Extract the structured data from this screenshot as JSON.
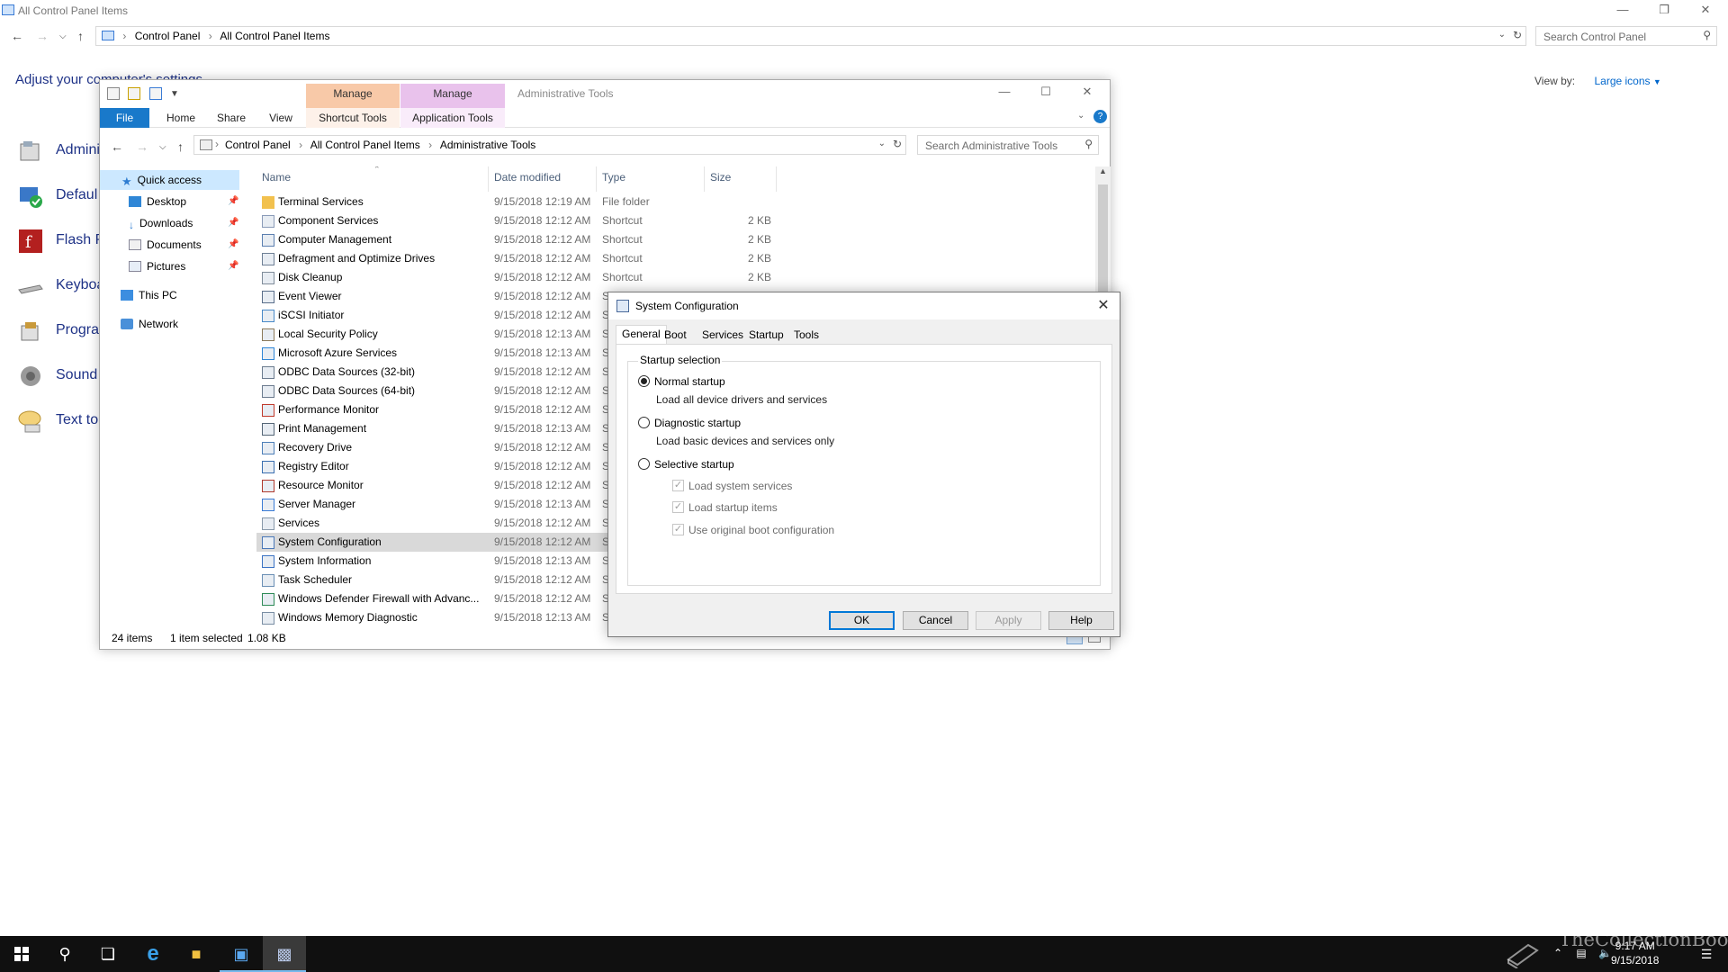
{
  "control_panel": {
    "window_title": "All Control Panel Items",
    "breadcrumbs": [
      "Control Panel",
      "All Control Panel Items"
    ],
    "search_placeholder": "Search Control Panel",
    "heading": "Adjust your computer's settings",
    "view_by_label": "View by:",
    "view_by_value": "Large icons",
    "items": [
      {
        "label": "Admini",
        "icon": "admin-tools-icon"
      },
      {
        "label": "Defaul",
        "icon": "default-programs-icon"
      },
      {
        "label": "Flash P",
        "icon": "flash-player-icon"
      },
      {
        "label": "Keyboa",
        "icon": "keyboard-icon"
      },
      {
        "label": "Progra",
        "icon": "programs-icon"
      },
      {
        "label": "Sound",
        "icon": "sound-icon"
      },
      {
        "label": "Text to",
        "icon": "text-to-speech-icon"
      }
    ]
  },
  "explorer": {
    "title": "Administrative Tools",
    "context_tabs": [
      {
        "label": "Manage",
        "group": "Shortcut Tools",
        "color": "#f8c9a8"
      },
      {
        "label": "Manage",
        "group": "Application Tools",
        "color": "#e9c2ec"
      }
    ],
    "ribbon_tabs": [
      "File",
      "Home",
      "Share",
      "View",
      "Shortcut Tools",
      "Application Tools"
    ],
    "breadcrumbs": [
      "Control Panel",
      "All Control Panel Items",
      "Administrative Tools"
    ],
    "search_placeholder": "Search Administrative Tools",
    "nav": {
      "quick_access": "Quick access",
      "desktop": "Desktop",
      "downloads": "Downloads",
      "documents": "Documents",
      "pictures": "Pictures",
      "this_pc": "This PC",
      "network": "Network"
    },
    "columns": [
      "Name",
      "Date modified",
      "Type",
      "Size"
    ],
    "rows": [
      {
        "name": "Terminal Services",
        "date": "9/15/2018 12:19 AM",
        "type": "File folder",
        "size": ""
      },
      {
        "name": "Component Services",
        "date": "9/15/2018 12:12 AM",
        "type": "Shortcut",
        "size": "2 KB"
      },
      {
        "name": "Computer Management",
        "date": "9/15/2018 12:12 AM",
        "type": "Shortcut",
        "size": "2 KB"
      },
      {
        "name": "Defragment and Optimize Drives",
        "date": "9/15/2018 12:12 AM",
        "type": "Shortcut",
        "size": "2 KB"
      },
      {
        "name": "Disk Cleanup",
        "date": "9/15/2018 12:12 AM",
        "type": "Shortcut",
        "size": "2 KB"
      },
      {
        "name": "Event Viewer",
        "date": "9/15/2018 12:12 AM",
        "type": "Shortcut",
        "size": "2 KB"
      },
      {
        "name": "iSCSI Initiator",
        "date": "9/15/2018 12:12 AM",
        "type": "S",
        "size": ""
      },
      {
        "name": "Local Security Policy",
        "date": "9/15/2018 12:13 AM",
        "type": "S",
        "size": ""
      },
      {
        "name": "Microsoft Azure Services",
        "date": "9/15/2018 12:13 AM",
        "type": "S",
        "size": ""
      },
      {
        "name": "ODBC Data Sources (32-bit)",
        "date": "9/15/2018 12:12 AM",
        "type": "S",
        "size": ""
      },
      {
        "name": "ODBC Data Sources (64-bit)",
        "date": "9/15/2018 12:12 AM",
        "type": "S",
        "size": ""
      },
      {
        "name": "Performance Monitor",
        "date": "9/15/2018 12:12 AM",
        "type": "S",
        "size": ""
      },
      {
        "name": "Print Management",
        "date": "9/15/2018 12:13 AM",
        "type": "S",
        "size": ""
      },
      {
        "name": "Recovery Drive",
        "date": "9/15/2018 12:12 AM",
        "type": "S",
        "size": ""
      },
      {
        "name": "Registry Editor",
        "date": "9/15/2018 12:12 AM",
        "type": "S",
        "size": ""
      },
      {
        "name": "Resource Monitor",
        "date": "9/15/2018 12:12 AM",
        "type": "S",
        "size": ""
      },
      {
        "name": "Server Manager",
        "date": "9/15/2018 12:13 AM",
        "type": "S",
        "size": ""
      },
      {
        "name": "Services",
        "date": "9/15/2018 12:12 AM",
        "type": "S",
        "size": ""
      },
      {
        "name": "System Configuration",
        "date": "9/15/2018 12:12 AM",
        "type": "S",
        "size": "",
        "selected": true
      },
      {
        "name": "System Information",
        "date": "9/15/2018 12:13 AM",
        "type": "S",
        "size": ""
      },
      {
        "name": "Task Scheduler",
        "date": "9/15/2018 12:12 AM",
        "type": "S",
        "size": ""
      },
      {
        "name": "Windows Defender Firewall with Advanc...",
        "date": "9/15/2018 12:12 AM",
        "type": "S",
        "size": ""
      },
      {
        "name": "Windows Memory Diagnostic",
        "date": "9/15/2018 12:13 AM",
        "type": "S",
        "size": ""
      }
    ],
    "status": {
      "count": "24 items",
      "selected": "1 item selected",
      "size": "1.08 KB"
    }
  },
  "dialog": {
    "title": "System Configuration",
    "tabs": [
      "General",
      "Boot",
      "Services",
      "Startup",
      "Tools"
    ],
    "group_label": "Startup selection",
    "normal": {
      "label": "Normal startup",
      "desc": "Load all device drivers and services",
      "checked": true
    },
    "diagnostic": {
      "label": "Diagnostic startup",
      "desc": "Load basic devices and services only",
      "checked": false
    },
    "selective": {
      "label": "Selective startup",
      "checked": false
    },
    "options": [
      "Load system services",
      "Load startup items",
      "Use original boot configuration"
    ],
    "buttons": {
      "ok": "OK",
      "cancel": "Cancel",
      "apply": "Apply",
      "help": "Help"
    }
  },
  "taskbar": {
    "time": "9:17 AM",
    "date": "9/15/2018",
    "watermark": "TheCollectionBook"
  },
  "colors": {
    "accent": "#0078d7",
    "file_tab": "#1979ca",
    "selection": "#d9d9d9",
    "link": "#1e3287"
  }
}
